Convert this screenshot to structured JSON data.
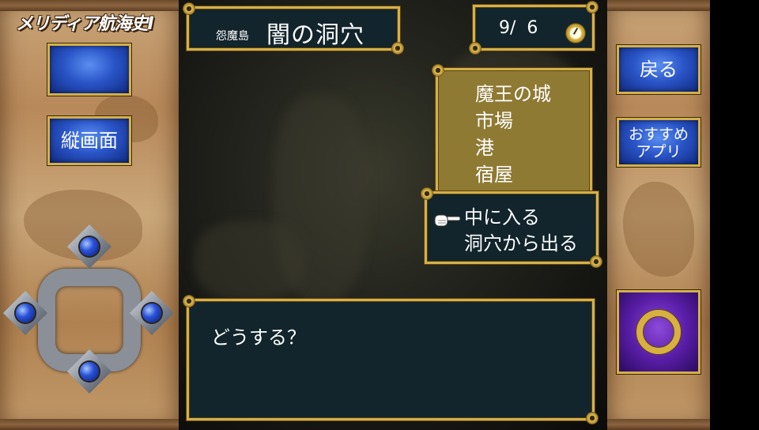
{
  "logo": "メリディア航海史Ⅰ",
  "location": {
    "region": "怨魔島",
    "name": "闇の洞穴"
  },
  "counter": {
    "text": "9/  6",
    "icon": "pocket-watch-icon"
  },
  "destinations": [
    "魔王の城",
    "市場",
    "港",
    "宿屋"
  ],
  "actions": [
    "中に入る",
    "洞穴から出る"
  ],
  "selected_action": 0,
  "message": "どうする？",
  "left_buttons": {
    "blank": "",
    "portrait": "縦画面"
  },
  "right_buttons": {
    "back": "戻る",
    "apps_line1": "おすすめ",
    "apps_line2": "アプリ"
  },
  "dpad": {
    "up": "dpad-up",
    "down": "dpad-down",
    "left": "dpad-left",
    "right": "dpad-right"
  },
  "colors": {
    "frame_gold": "#d4b04a",
    "dialog_bg": "#12242c",
    "menu_bg": "#8f7a34",
    "button_blue": "#2a55c8",
    "ok_purple": "#5a1ea8"
  }
}
